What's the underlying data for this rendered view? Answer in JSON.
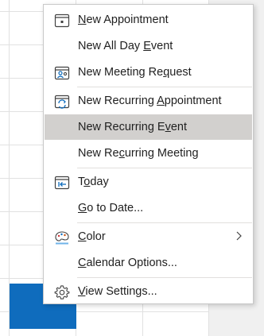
{
  "menu": {
    "items": [
      {
        "id": "new-appointment",
        "pre": "",
        "ul": "N",
        "post": "ew Appointment",
        "icon": "calendar-appointment-icon"
      },
      {
        "id": "new-all-day-event",
        "pre": "New All Day ",
        "ul": "E",
        "post": "vent",
        "icon": ""
      },
      {
        "id": "new-meeting-request",
        "pre": "New Meeting Re",
        "ul": "q",
        "post": "uest",
        "icon": "meeting-request-icon"
      },
      {
        "id": "new-recurring-appointment",
        "pre": "New Recurring ",
        "ul": "A",
        "post": "ppointment",
        "icon": "recurring-appointment-icon"
      },
      {
        "id": "new-recurring-event",
        "pre": "New Recurring E",
        "ul": "v",
        "post": "ent",
        "icon": "",
        "highlighted": true
      },
      {
        "id": "new-recurring-meeting",
        "pre": "New Re",
        "ul": "c",
        "post": "urring Meeting",
        "icon": ""
      },
      {
        "id": "today",
        "pre": "T",
        "ul": "o",
        "post": "day",
        "icon": "today-icon"
      },
      {
        "id": "go-to-date",
        "pre": "",
        "ul": "G",
        "post": "o to Date...",
        "icon": ""
      },
      {
        "id": "color",
        "pre": "",
        "ul": "C",
        "post": "olor",
        "icon": "palette-icon",
        "submenu": true
      },
      {
        "id": "calendar-options",
        "pre": "",
        "ul": "C",
        "post": "alendar Options...",
        "icon": ""
      },
      {
        "id": "view-settings",
        "pre": "",
        "ul": "V",
        "post": "iew Settings...",
        "icon": "gear-icon"
      }
    ]
  },
  "colors": {
    "highlight": "#d2d0ce",
    "accent_blue": "#0f6cbd"
  }
}
